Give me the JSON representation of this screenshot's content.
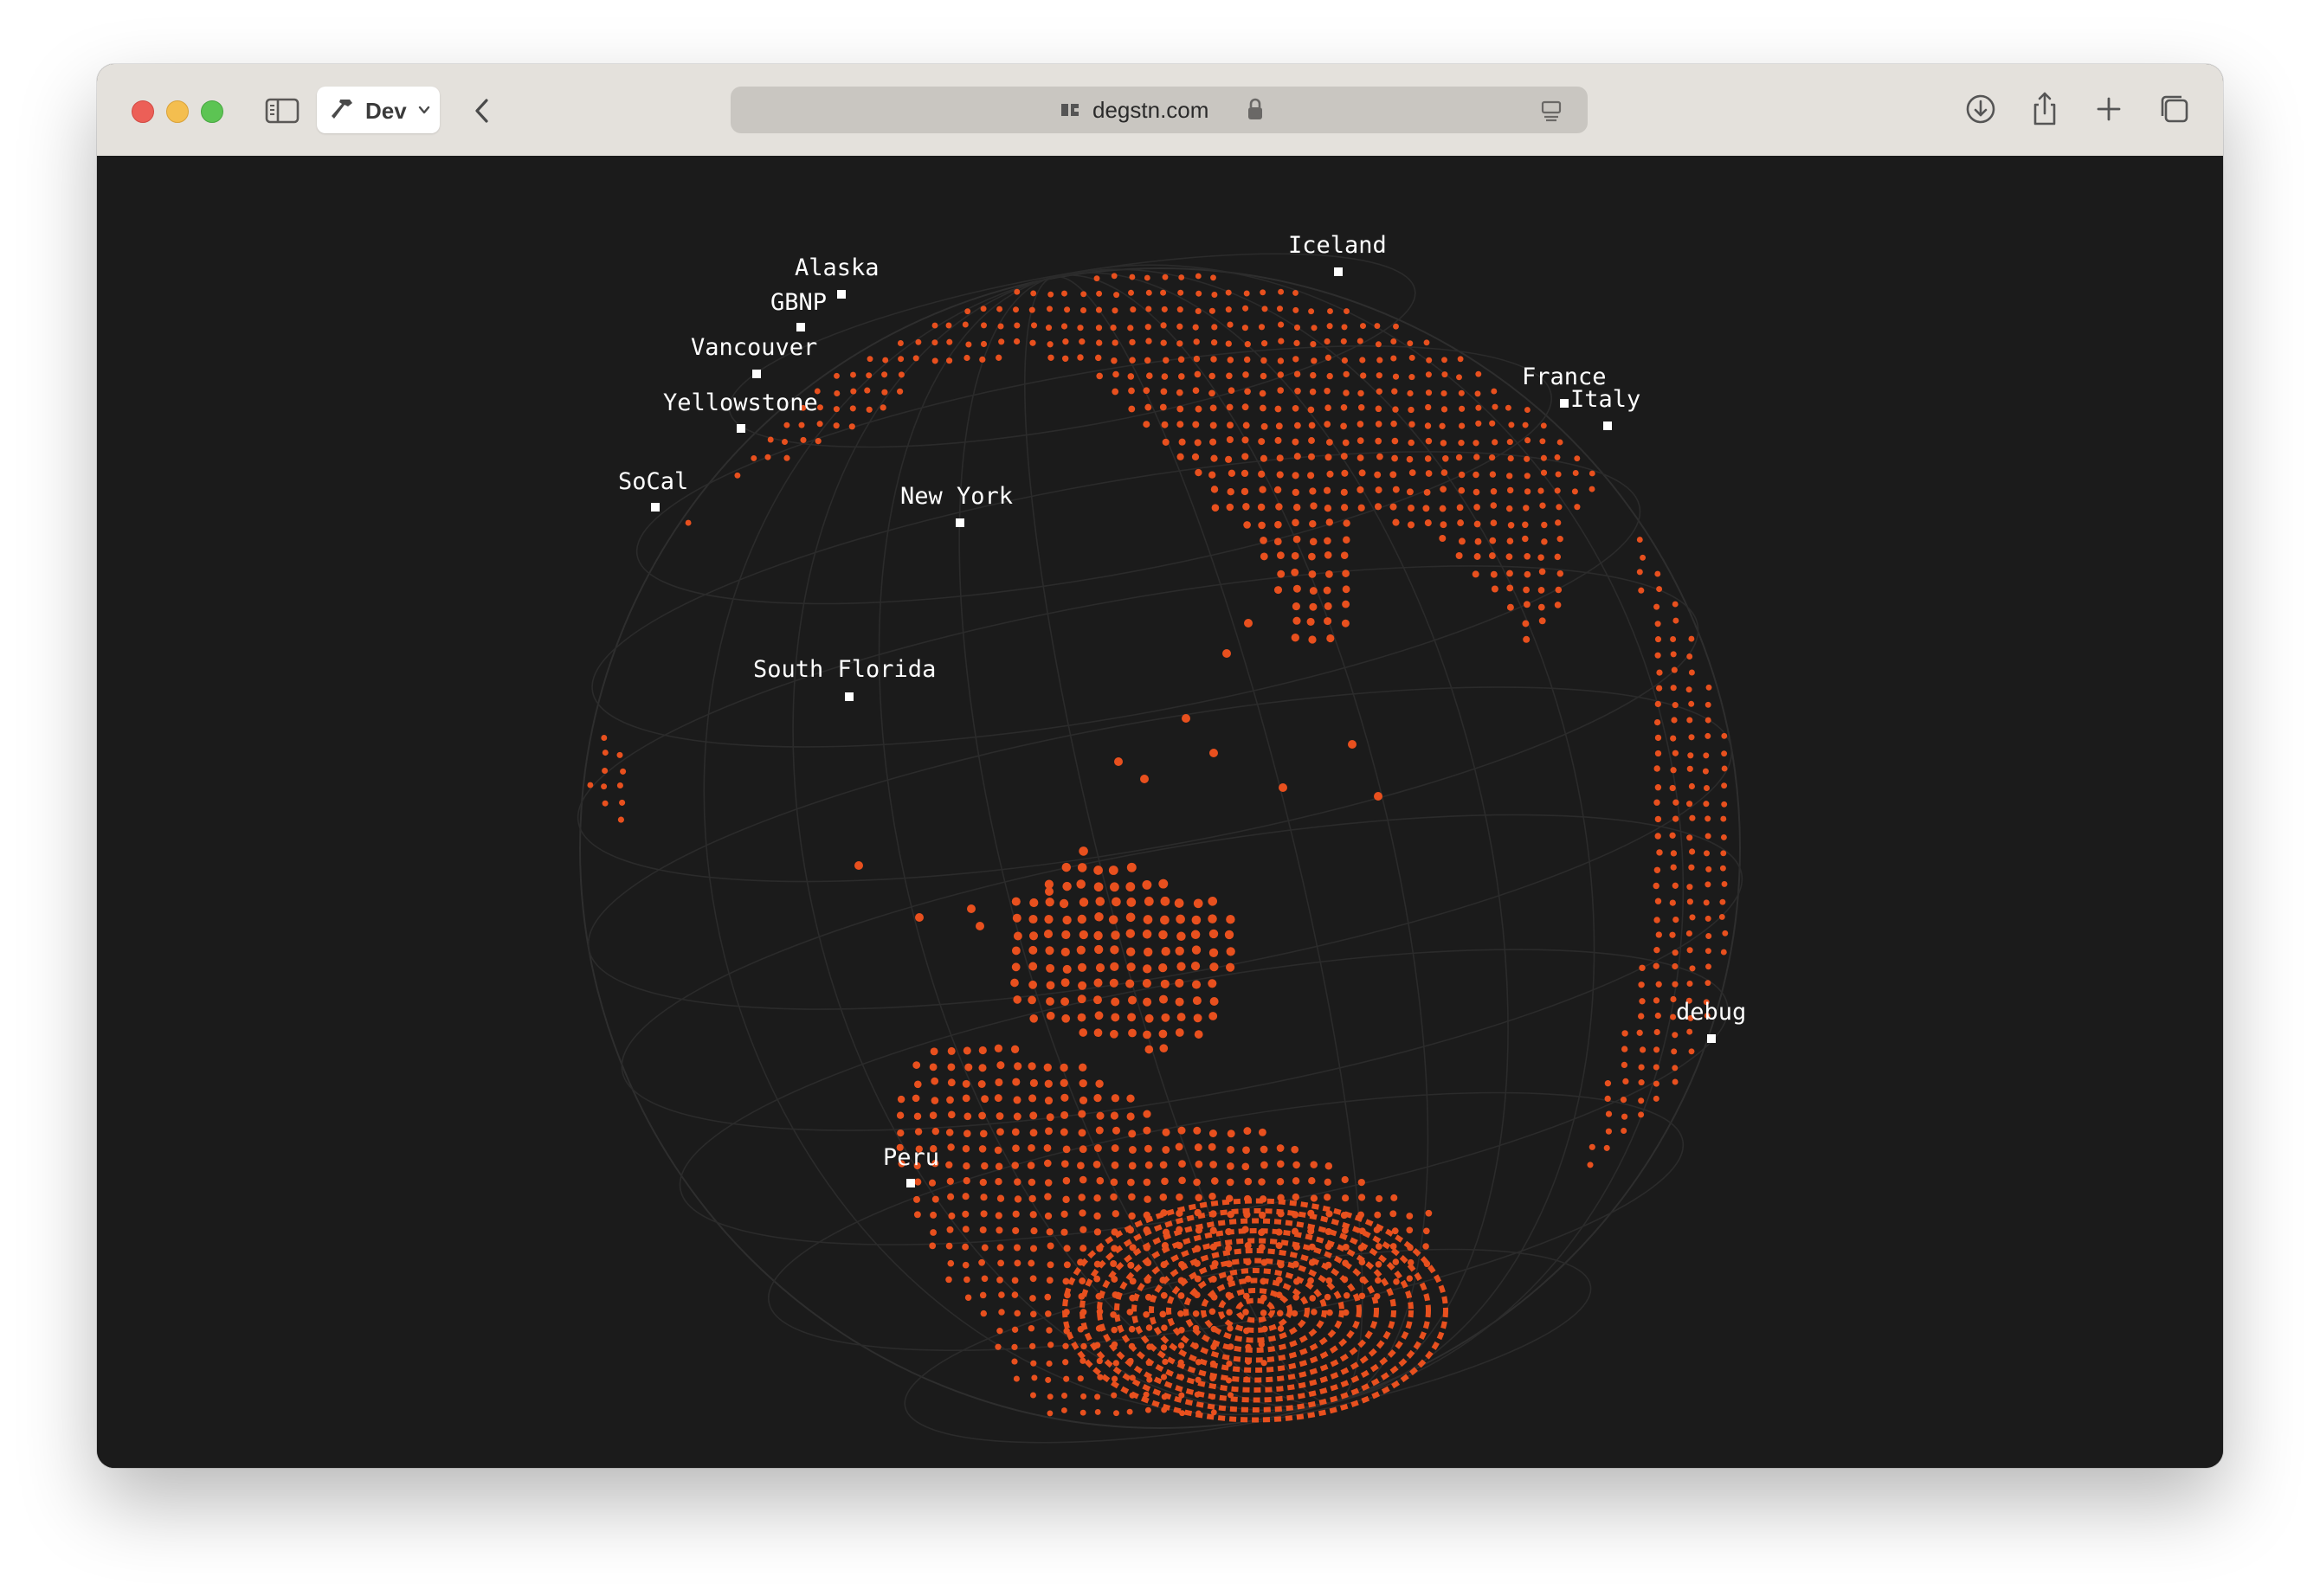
{
  "browser": {
    "profile_label": "Dev",
    "url": "degstn.com"
  },
  "icons": {
    "sidebar": "sidebar-icon",
    "profile": "hammer-icon",
    "back": "chevron-left-icon",
    "site": "site-favicon-icon",
    "lock": "lock-icon",
    "reader": "reader-icon",
    "download": "download-icon",
    "share": "share-icon",
    "new_tab": "plus-icon",
    "tab_overview": "tabs-icon"
  },
  "globe": {
    "dot_color": "#e8501e",
    "background": "#1b1b1b",
    "locations": [
      {
        "id": "alaska",
        "label": "Alaska"
      },
      {
        "id": "gbnp",
        "label": "GBNP"
      },
      {
        "id": "vancouver",
        "label": "Vancouver"
      },
      {
        "id": "yellowstone",
        "label": "Yellowstone"
      },
      {
        "id": "socal",
        "label": "SoCal"
      },
      {
        "id": "new-york",
        "label": "New York"
      },
      {
        "id": "south-florida",
        "label": "South Florida"
      },
      {
        "id": "iceland",
        "label": "Iceland"
      },
      {
        "id": "france",
        "label": "France"
      },
      {
        "id": "italy",
        "label": "Italy"
      },
      {
        "id": "debug",
        "label": "debug"
      },
      {
        "id": "peru",
        "label": "Peru"
      }
    ]
  }
}
